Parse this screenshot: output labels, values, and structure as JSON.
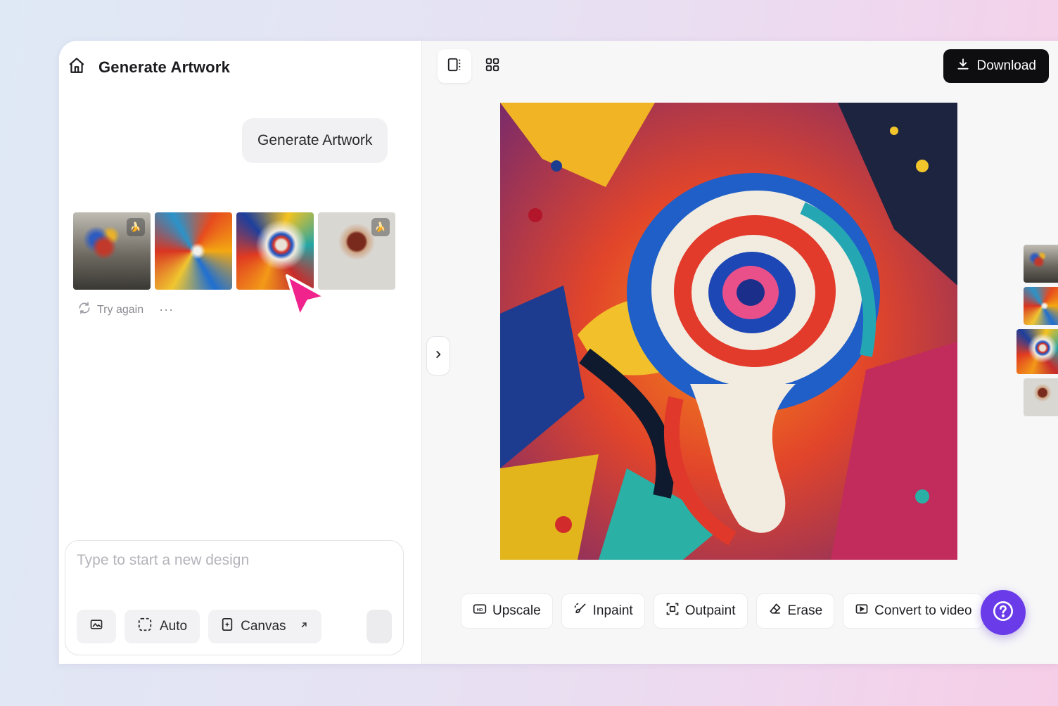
{
  "header": {
    "title": "Generate Artwork"
  },
  "chat": {
    "prompt": "Generate Artwork"
  },
  "results": {
    "try_again_label": "Try again",
    "more_label": "···"
  },
  "composer": {
    "placeholder": "Type to start a new design",
    "auto_label": "Auto",
    "canvas_label": "Canvas"
  },
  "toolbar": {
    "download_label": "Download"
  },
  "actions": {
    "upscale": "Upscale",
    "inpaint": "Inpaint",
    "outpaint": "Outpaint",
    "erase": "Erase",
    "convert": "Convert to video"
  },
  "colors": {
    "accent": "#6a3be8",
    "cursor": "#f0238c",
    "download_bg": "#0e0e10"
  },
  "icons": {
    "home": "home-icon",
    "image": "image-icon",
    "auto": "auto-frame-icon",
    "canvas": "canvas-icon",
    "external": "external-link-icon",
    "help": "help-icon"
  }
}
